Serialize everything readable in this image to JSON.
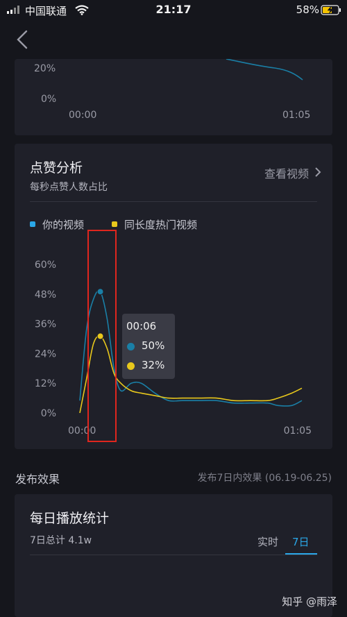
{
  "status_bar": {
    "carrier": "中国联通",
    "time": "21:17",
    "battery_pct": "58%"
  },
  "colors": {
    "series_user": "#1a7fa6",
    "series_hot": "#e8c81c",
    "accent_blue": "#2aa7e8",
    "highlight_red": "#e0261e"
  },
  "top_chart": {
    "y_ticks": [
      "20%",
      "0%"
    ],
    "x_ticks": [
      "00:00",
      "01:05"
    ]
  },
  "like_card": {
    "title": "点赞分析",
    "subtitle": "每秒点赞人数占比",
    "view_link": "查看视频",
    "legend": [
      "你的视频",
      "同长度热门视频"
    ],
    "tooltip": {
      "time": "00:06",
      "user_value": "50%",
      "hot_value": "32%"
    }
  },
  "chart_data": {
    "type": "line",
    "title": "点赞分析",
    "subtitle": "每秒点赞人数占比",
    "x_ticks": [
      "00:00",
      "01:05"
    ],
    "y_ticks": [
      "60%",
      "48%",
      "36%",
      "24%",
      "12%",
      "0%"
    ],
    "ylim": [
      0,
      60
    ],
    "xlim": [
      0,
      65
    ],
    "grid": false,
    "legend_position": "top-left",
    "series": [
      {
        "name": "你的视频",
        "x": [
          0,
          2,
          4,
          6,
          8,
          10,
          12,
          15,
          18,
          22,
          26,
          30,
          35,
          40,
          45,
          50,
          55,
          58,
          62,
          65
        ],
        "y": [
          5,
          34,
          46,
          49,
          38,
          18,
          9,
          12,
          12,
          8,
          5,
          5,
          5,
          5,
          4,
          4,
          4,
          3,
          3,
          5
        ]
      },
      {
        "name": "同长度热门视频",
        "x": [
          0,
          2,
          4,
          6,
          8,
          10,
          12,
          15,
          18,
          22,
          26,
          30,
          35,
          40,
          45,
          50,
          55,
          58,
          62,
          65
        ],
        "y": [
          0,
          14,
          28,
          31,
          26,
          16,
          12,
          9,
          8,
          7,
          6,
          6,
          6,
          6,
          5,
          5,
          5,
          6,
          8,
          10
        ]
      }
    ]
  },
  "publish_section": {
    "label": "发布效果",
    "range": "发布7日内效果 (06.19-06.25)"
  },
  "daily_card": {
    "title": "每日播放统计",
    "summary": "7日总计 4.1w",
    "tabs": [
      "实时",
      "7日"
    ]
  },
  "watermark": "知乎 @雨泽"
}
